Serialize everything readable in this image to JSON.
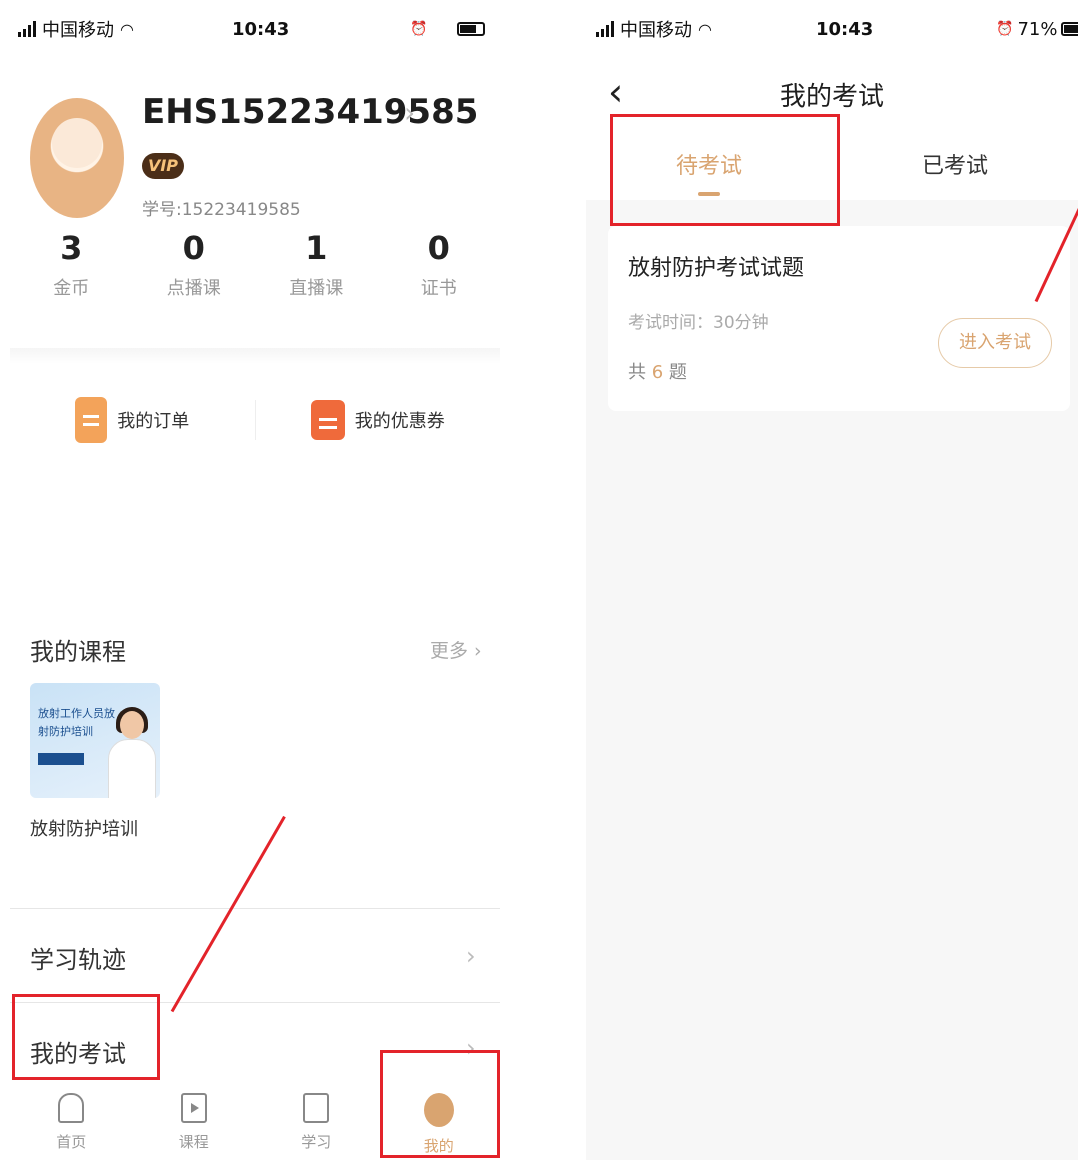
{
  "left": {
    "status": {
      "carrier": "中国移动",
      "time": "10:43"
    },
    "profile": {
      "username": "EHS15223419585",
      "vip": "VIP",
      "student_id": "学号:15223419585"
    },
    "stats": [
      {
        "value": "3",
        "label": "金币"
      },
      {
        "value": "0",
        "label": "点播课"
      },
      {
        "value": "1",
        "label": "直播课"
      },
      {
        "value": "0",
        "label": "证书"
      }
    ],
    "quick": {
      "orders": "我的订单",
      "coupons": "我的优惠券"
    },
    "courses": {
      "title": "我的课程",
      "more": "更多 ›",
      "item_name": "放射防护培训",
      "thumb_text": "放射工作人员放射防护培训"
    },
    "rows": {
      "track": "学习轨迹",
      "exam": "我的考试",
      "chev": "›"
    },
    "tabbar": [
      {
        "label": "首页",
        "icon": "home-icon"
      },
      {
        "label": "课程",
        "icon": "play-icon"
      },
      {
        "label": "学习",
        "icon": "bookmark-icon"
      },
      {
        "label": "我的",
        "icon": "profile-icon"
      }
    ],
    "accent": "#d9a470",
    "highlight": "#e3232a"
  },
  "right": {
    "status": {
      "carrier": "中国移动",
      "time": "10:43",
      "battery": "71%"
    },
    "nav": {
      "back": "‹",
      "title": "我的考试"
    },
    "tabs": {
      "pending": "待考试",
      "done": "已考试"
    },
    "exam": {
      "title": "放射防护考试试题",
      "time": "考试时间：30分钟",
      "count_prefix": "共",
      "count": "6",
      "count_suffix": "题",
      "enter": "进入考试"
    }
  }
}
